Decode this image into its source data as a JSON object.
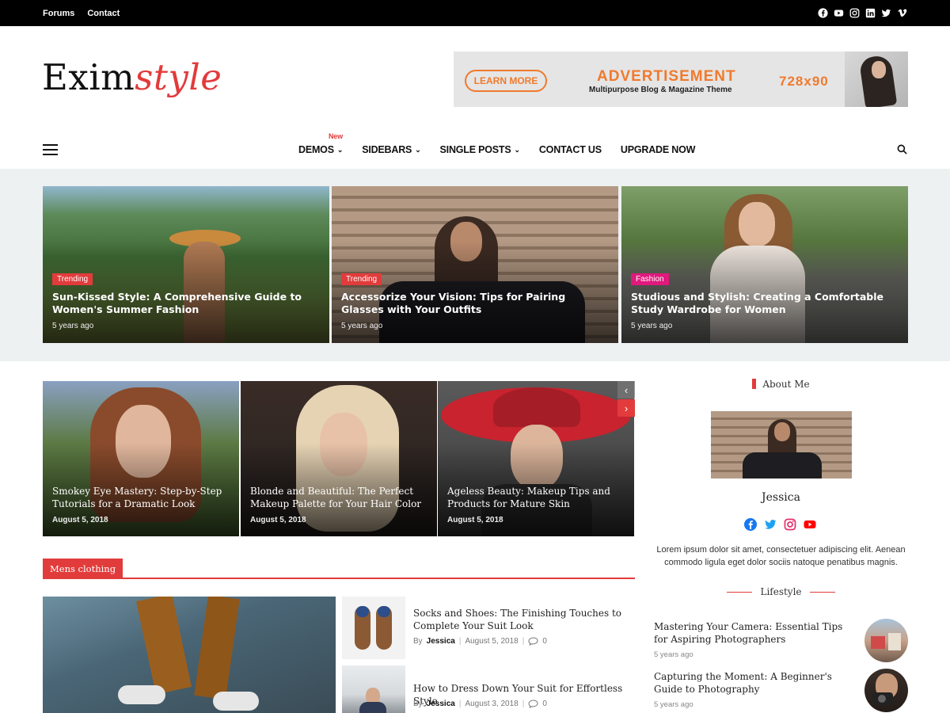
{
  "topbar": {
    "links": [
      "Forums",
      "Contact"
    ],
    "social_icons": [
      "facebook-icon",
      "youtube-icon",
      "instagram-icon",
      "linkedin-icon",
      "twitter-icon",
      "vimeo-icon"
    ]
  },
  "brand": {
    "logo_part1": "Exim",
    "logo_part2": "style",
    "accent": "#e23b3b"
  },
  "ad": {
    "button": "LEARN MORE",
    "title": "ADVERTISEMENT",
    "subtitle": "Multipurpose Blog & Magazine Theme",
    "size": "728x90",
    "accent": "#f07a2d"
  },
  "nav": {
    "items": [
      {
        "label": "DEMOS",
        "badge": "New",
        "dropdown": true
      },
      {
        "label": "SIDEBARS",
        "dropdown": true
      },
      {
        "label": "SINGLE POSTS",
        "dropdown": true
      },
      {
        "label": "CONTACT US",
        "dropdown": false
      },
      {
        "label": "UPGRADE NOW",
        "dropdown": false
      }
    ]
  },
  "featured": [
    {
      "tag": "Trending",
      "tag_color": "#e23b3b",
      "title": "Sun-Kissed Style: A Comprehensive Guide to Women's Summer Fashion",
      "time": "5 years ago"
    },
    {
      "tag": "Trending",
      "tag_color": "#e23b3b",
      "title": "Accessorize Your Vision: Tips for Pairing Glasses with Your Outfits",
      "time": "5 years ago"
    },
    {
      "tag": "Fashion",
      "tag_color": "#e0197d",
      "title": "Studious and Stylish: Creating a Comfortable Study Wardrobe for Women",
      "time": "5 years ago"
    }
  ],
  "slider": {
    "slides": [
      {
        "title": "Smokey Eye Mastery: Step-by-Step Tutorials for a Dramatic Look",
        "date": "August 5, 2018"
      },
      {
        "title": "Blonde and Beautiful: The Perfect Makeup Palette for Your Hair Color",
        "date": "August 5, 2018"
      },
      {
        "title": "Ageless Beauty: Makeup Tips and Products for Mature Skin",
        "date": "August 5, 2018"
      }
    ],
    "prev": "‹",
    "next": "›"
  },
  "category": {
    "label": "Mens clothing",
    "posts": [
      {
        "title": "Socks and Shoes: The Finishing Touches to Complete Your Suit Look",
        "by": "By",
        "author": "Jessica",
        "date": "August 5, 2018",
        "comments": "0"
      },
      {
        "title": "How to Dress Down Your Suit for Effortless Style",
        "by": "By",
        "author": "Jessica",
        "date": "August 3, 2018",
        "comments": "0"
      }
    ]
  },
  "sidebar": {
    "about": {
      "heading": "About Me",
      "name": "Jessica",
      "social_icons": [
        "facebook-icon",
        "twitter-icon",
        "instagram-icon",
        "youtube-icon"
      ],
      "text": "Lorem ipsum dolor sit amet, consectetuer adipiscing elit. Aenean commodo ligula eget dolor sociis natoque penatibus magnis."
    },
    "lifestyle": {
      "heading": "Lifestyle",
      "posts": [
        {
          "title": "Mastering Your Camera: Essential Tips for Aspiring Photographers",
          "time": "5 years ago"
        },
        {
          "title": "Capturing the Moment: A Beginner's Guide to Photography",
          "time": "5 years ago"
        }
      ]
    }
  }
}
